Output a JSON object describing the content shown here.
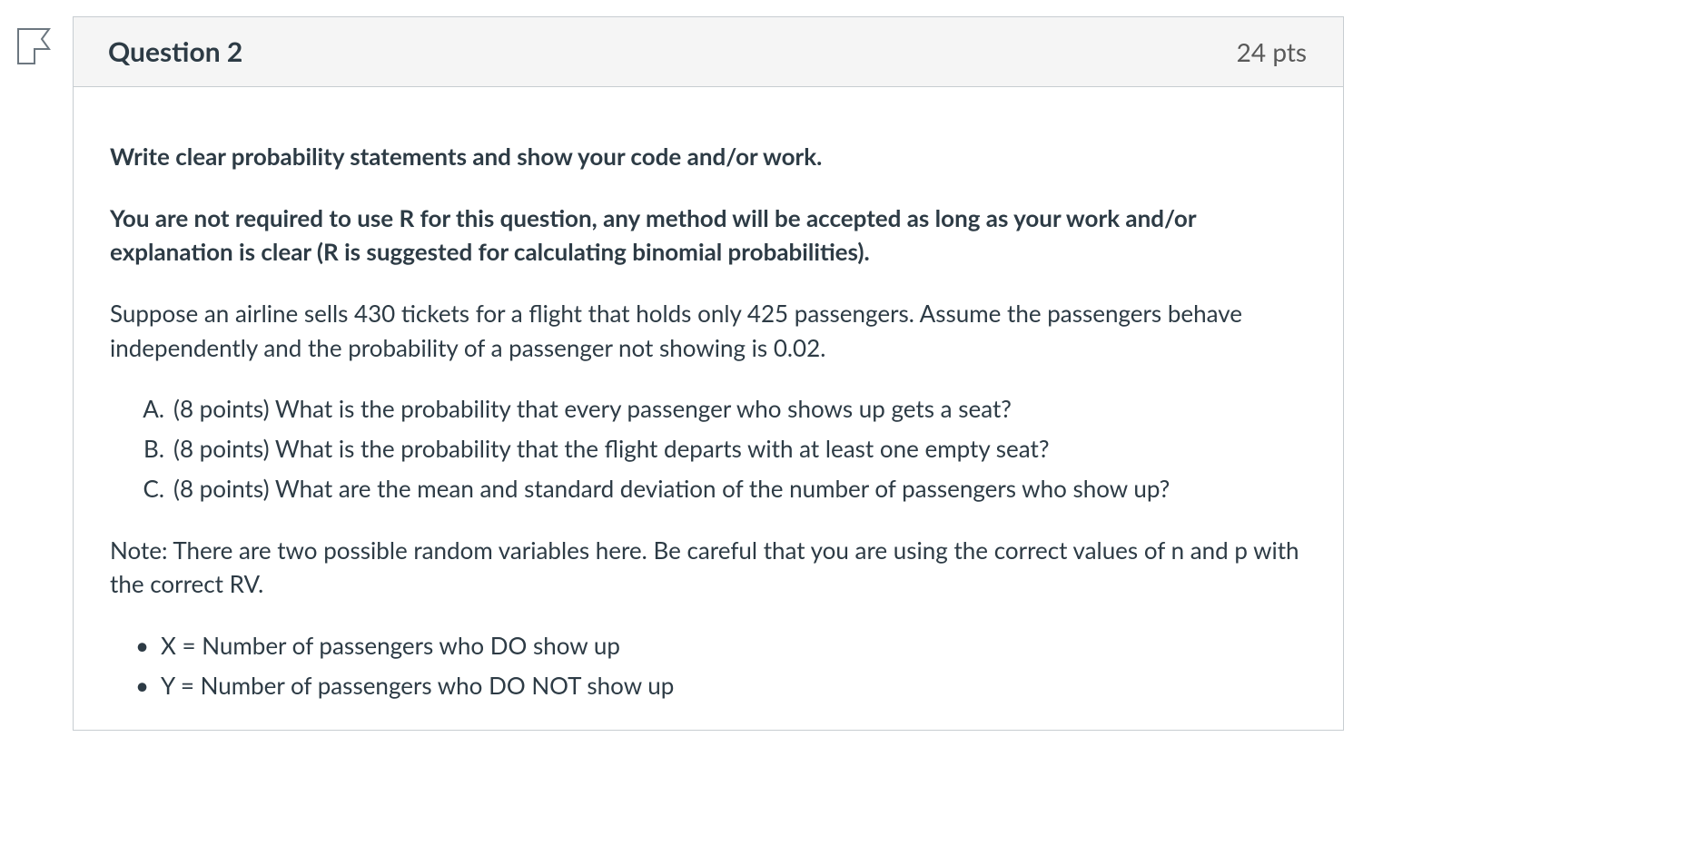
{
  "header": {
    "title": "Question 2",
    "points": "24 pts"
  },
  "body": {
    "instruction1": "Write clear probability statements and show your code and/or work.",
    "instruction2": "You are not required to use R for this question, any method will be accepted as long as your work and/or explanation is clear (R is suggested for calculating binomial probabilities).",
    "scenario": "Suppose an airline sells 430 tickets for a flight that holds only 425 passengers. Assume the passengers behave independently and the probability of a passenger not showing is 0.02.",
    "parts": [
      {
        "marker": "A.",
        "text": "(8 points) What is the probability that every passenger who shows up gets a seat?"
      },
      {
        "marker": "B.",
        "text": "(8 points) What is the probability that the flight departs with at least one empty seat?"
      },
      {
        "marker": "C.",
        "text": "(8 points) What are the mean and standard deviation of the number of passengers who show up?"
      }
    ],
    "note": "Note: There are two possible random variables here. Be careful that you are using the correct values of n and p with the correct RV.",
    "bullets": [
      "X = Number of passengers who DO show up",
      "Y = Number of passengers who DO NOT show up"
    ]
  }
}
